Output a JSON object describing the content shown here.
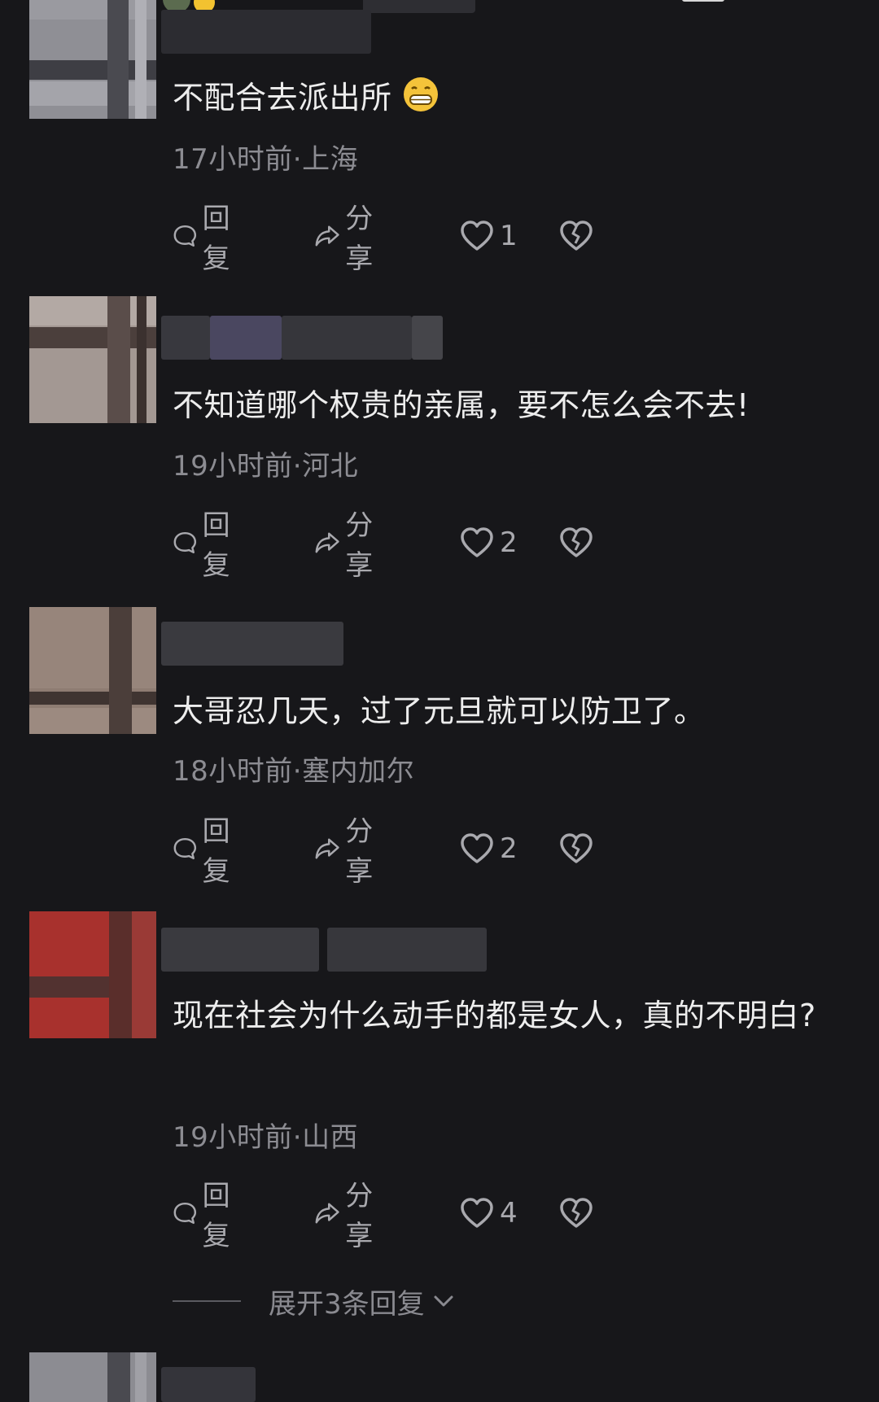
{
  "comments": [
    {
      "text": "不配合去派出所",
      "emoji": "grinning-face-emoji",
      "meta": "17小时前·上海",
      "reply_label": "回复",
      "share_label": "分享",
      "likes": "1"
    },
    {
      "text": "不知道哪个权贵的亲属，要不怎么会不去!",
      "meta": "19小时前·河北",
      "reply_label": "回复",
      "share_label": "分享",
      "likes": "2"
    },
    {
      "text": "大哥忍几天，过了元旦就可以防卫了。",
      "meta": "18小时前·塞内加尔",
      "reply_label": "回复",
      "share_label": "分享",
      "likes": "2"
    },
    {
      "text": "现在社会为什么动手的都是女人，真的不明白?",
      "meta": "19小时前·山西",
      "reply_label": "回复",
      "share_label": "分享",
      "likes": "4"
    }
  ],
  "expand_label": "展开3条回复",
  "icons": {
    "reply": "comment-bubble-icon",
    "share": "share-arrow-icon",
    "like": "heart-icon",
    "dislike": "broken-heart-icon",
    "expand": "chevron-down-icon"
  },
  "colors": {
    "background": "#17171a",
    "text": "#ededed",
    "meta": "#8c8c92",
    "action": "#a9a9ae"
  }
}
